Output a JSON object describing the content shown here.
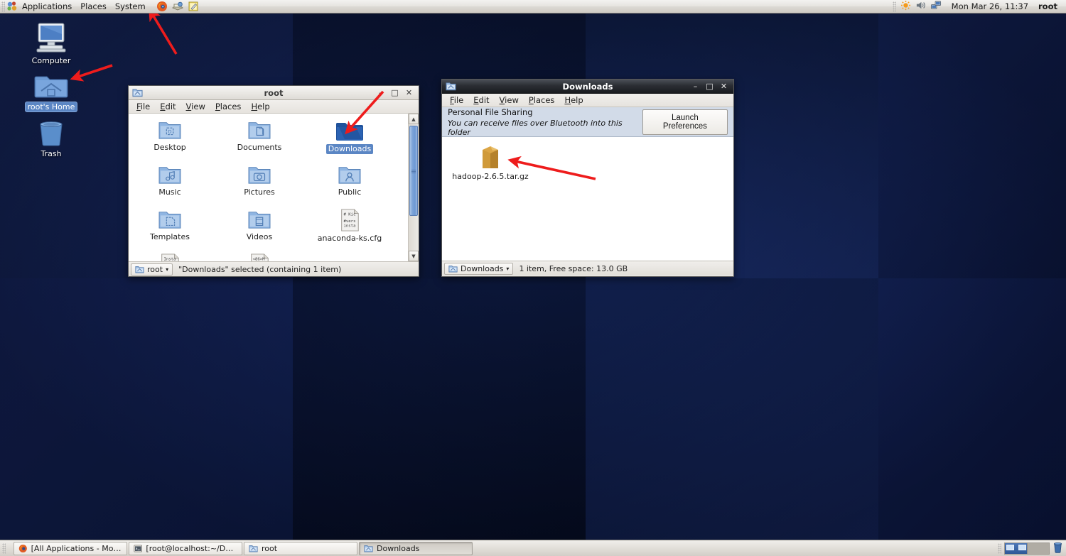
{
  "top_panel": {
    "menus": [
      "Applications",
      "Places",
      "System"
    ],
    "launchers": [
      {
        "name": "firefox-launcher-icon",
        "label": "Firefox Web Browser"
      },
      {
        "name": "evolution-launcher-icon",
        "label": "Evolution Mail"
      },
      {
        "name": "gedit-launcher-icon",
        "label": "Text Editor"
      }
    ],
    "tray": [
      {
        "name": "brightness-tray-icon",
        "label": "Brightness Applet"
      },
      {
        "name": "volume-tray-icon",
        "label": "Volume Control"
      },
      {
        "name": "network-tray-icon",
        "label": "Network Connections"
      }
    ],
    "clock": "Mon Mar 26, 11:37",
    "user": "root"
  },
  "desktop_icons": [
    {
      "name": "computer",
      "label": "Computer",
      "icon": "computer-icon",
      "selected": false
    },
    {
      "name": "roots-home",
      "label": "root's Home",
      "icon": "home-folder-icon",
      "selected": true
    },
    {
      "name": "trash",
      "label": "Trash",
      "icon": "trash-icon",
      "selected": false
    }
  ],
  "root_window": {
    "title": "root",
    "icon": "folder-window-icon",
    "active": false,
    "menus": [
      "File",
      "Edit",
      "View",
      "Places",
      "Help"
    ],
    "window_buttons": {
      "minimize": "–",
      "maximize": "□",
      "close": "✕"
    },
    "items": [
      {
        "label": "Desktop",
        "icon": "folder-desktop-icon",
        "selected": false
      },
      {
        "label": "Documents",
        "icon": "folder-documents-icon",
        "selected": false
      },
      {
        "label": "Downloads",
        "icon": "folder-downloads-icon",
        "selected": true
      },
      {
        "label": "Music",
        "icon": "folder-music-icon",
        "selected": false
      },
      {
        "label": "Pictures",
        "icon": "folder-pictures-icon",
        "selected": false
      },
      {
        "label": "Public",
        "icon": "folder-public-icon",
        "selected": false
      },
      {
        "label": "Templates",
        "icon": "folder-templates-icon",
        "selected": false
      },
      {
        "label": "Videos",
        "icon": "folder-videos-icon",
        "selected": false
      },
      {
        "label": "anaconda-ks.cfg",
        "icon": "text-file-icon",
        "selected": false
      }
    ],
    "partial_items": [
      {
        "preview": "Insta",
        "icon": "text-file-icon"
      },
      {
        "preview": "<86>M",
        "icon": "text-file-icon"
      }
    ],
    "path_button": "root",
    "status": "\"Downloads\" selected (containing 1 item)"
  },
  "downloads_window": {
    "title": "Downloads",
    "icon": "folder-window-icon",
    "active": true,
    "menus": [
      "File",
      "Edit",
      "View",
      "Places",
      "Help"
    ],
    "window_buttons": {
      "minimize": "–",
      "maximize": "□",
      "close": "✕"
    },
    "infobar": {
      "heading": "Personal File Sharing",
      "description": "You can receive files over Bluetooth into this folder",
      "button": "Launch Preferences"
    },
    "items": [
      {
        "label": "hadoop-2.6.5.tar.gz",
        "icon": "archive-file-icon",
        "selected": false
      }
    ],
    "path_button": "Downloads",
    "status": "1 item, Free space: 13.0 GB"
  },
  "bottom_panel": {
    "tasks": [
      {
        "label": "[All Applications - Moz...",
        "icon": "firefox-icon",
        "pressed": false
      },
      {
        "label": "[root@localhost:~/Des...",
        "icon": "terminal-icon",
        "pressed": false
      },
      {
        "label": "root",
        "icon": "folder-window-icon",
        "pressed": false
      },
      {
        "label": "Downloads",
        "icon": "folder-window-icon",
        "pressed": true
      }
    ],
    "workspaces": [
      {
        "name": "workspace-1",
        "active": true
      },
      {
        "name": "workspace-2",
        "active": false
      }
    ],
    "trash_applet": "trash-applet-icon"
  },
  "colors": {
    "desktop_bg": "#0a1430",
    "selection_blue": "#5b86c4",
    "arrow_red": "#ee1c1c",
    "active_title_bg": "#23262b",
    "infobar_bg": "#d2dbe8"
  },
  "annotations": [
    {
      "name": "arrow-to-applications-panel"
    },
    {
      "name": "arrow-to-roots-home-icon"
    },
    {
      "name": "arrow-to-downloads-folder"
    },
    {
      "name": "arrow-to-hadoop-archive"
    }
  ]
}
